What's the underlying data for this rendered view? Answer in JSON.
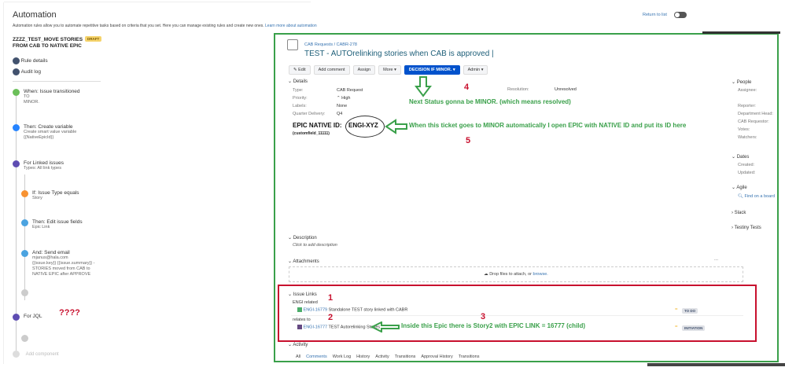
{
  "header": {
    "title": "Automation",
    "description": "Automation rules allow you to automate repetitive tasks based on criteria that you set. Here you can manage existing rules and create new ones.",
    "learn_more": "Learn more about automation",
    "return_to_list": "Return to list"
  },
  "rule": {
    "name_line1": "ZZZZ_TEST_MOVE STORIES",
    "name_line2": "FROM CAB TO NATIVE EPIC",
    "badge": "DRAFT",
    "rule_details": "Rule details",
    "audit_log": "Audit log"
  },
  "steps": [
    {
      "title": "When: Issue transitioned",
      "sub": [
        "TO",
        "MINOR."
      ],
      "color": "#6bbf59"
    },
    {
      "title": "Then: Create variable",
      "sub": [
        "Create smart value variable",
        "{{NativeEpicId}}"
      ],
      "color": "#2684ff"
    },
    {
      "title": "For Linked issues",
      "sub": [
        "Types: All link types"
      ],
      "color": "#5e4db2"
    },
    {
      "title": "If: Issue Type equals",
      "sub": [
        "Story"
      ],
      "color": "#f79232"
    },
    {
      "title": "Then: Edit issue fields",
      "sub": [
        "Epic Link"
      ],
      "color": "#4ba3e0"
    },
    {
      "title": "And: Send email",
      "sub": [
        "mjanus@hala.com",
        "{{issue.key}} {{issue.summary}} -",
        "STORIES moved from CAB to",
        "NATIVE EPIC  after APPROVE"
      ],
      "color": "#4ba3e0"
    },
    {
      "title": "For JQL",
      "color": "#5e4db2"
    }
  ],
  "add_component": "Add component",
  "annotations": {
    "qmarks": "????",
    "n1": "1",
    "n2": "2",
    "n3": "3",
    "n4": "4",
    "n5": "5",
    "next_status": "Next Status gonna be MINOR. (which means resolved)",
    "when_minor": "When this ticket goes to MINOR automatically I open EPIC with NATIVE ID and put its ID here",
    "inside_epic": "Inside this Epic there is Story2 with EPIC LINK = 16777 (child)"
  },
  "issue": {
    "breadcrumb_project": "CAB Requests",
    "breadcrumb_sep": "/",
    "breadcrumb_key": "CABR-278",
    "title": "TEST - AUTOrelinking stories when CAB is approved |",
    "buttons": {
      "edit": "✎ Edit",
      "comment": "Add comment",
      "assign": "Assign",
      "more": "More ▾",
      "decision": "DECISION IF MINOR. ▾",
      "admin": "Admin ▾"
    },
    "details_label": "Details",
    "fields": [
      {
        "label": "Type:",
        "value": "CAB Request"
      },
      {
        "label": "Priority:",
        "value": "⌃ High"
      },
      {
        "label": "Labels:",
        "value": "None"
      },
      {
        "label": "Quarter Delivery:",
        "value": "Q4"
      }
    ],
    "resolution_label": "Resolution:",
    "resolution_value": "Unresolved",
    "epic_native_label": "EPIC NATIVE ID:",
    "epic_native_value": "ENGI-XYZ",
    "customfield": "(customfield_11111)",
    "description_label": "Description",
    "description_placeholder": "Click to add description",
    "attachments_label": "Attachments",
    "attachments_more": "...",
    "drop_text": "Drop files to attach, or",
    "browse": "browse.",
    "issue_links_label": "Issue Links",
    "link_groups": [
      {
        "type": "ENGI related",
        "key": "ENGI-16779",
        "summary": "Standalone TEST story linked with CABR",
        "status": "TO DO"
      },
      {
        "type": "relates to",
        "key": "ENGI-16777",
        "summary": "TEST Autorelinking Stories",
        "status": "INITIATION"
      }
    ],
    "activity_label": "Activity",
    "activity_tabs": [
      "All",
      "Comments",
      "Work Log",
      "History",
      "Activity",
      "Transitions",
      "Approval History",
      "Transitions"
    ]
  },
  "sidebar": {
    "people": "People",
    "people_fields": [
      "Assignee:",
      "Reporter:",
      "Department Head:",
      "CAB Requestor:",
      "Votes:",
      "Watchers:"
    ],
    "dates": "Dates",
    "dates_fields": [
      "Created:",
      "Updated:"
    ],
    "agile": "Agile",
    "find_board": "Find on a board",
    "slack": "Slack",
    "testiny": "Testiny Tests"
  }
}
